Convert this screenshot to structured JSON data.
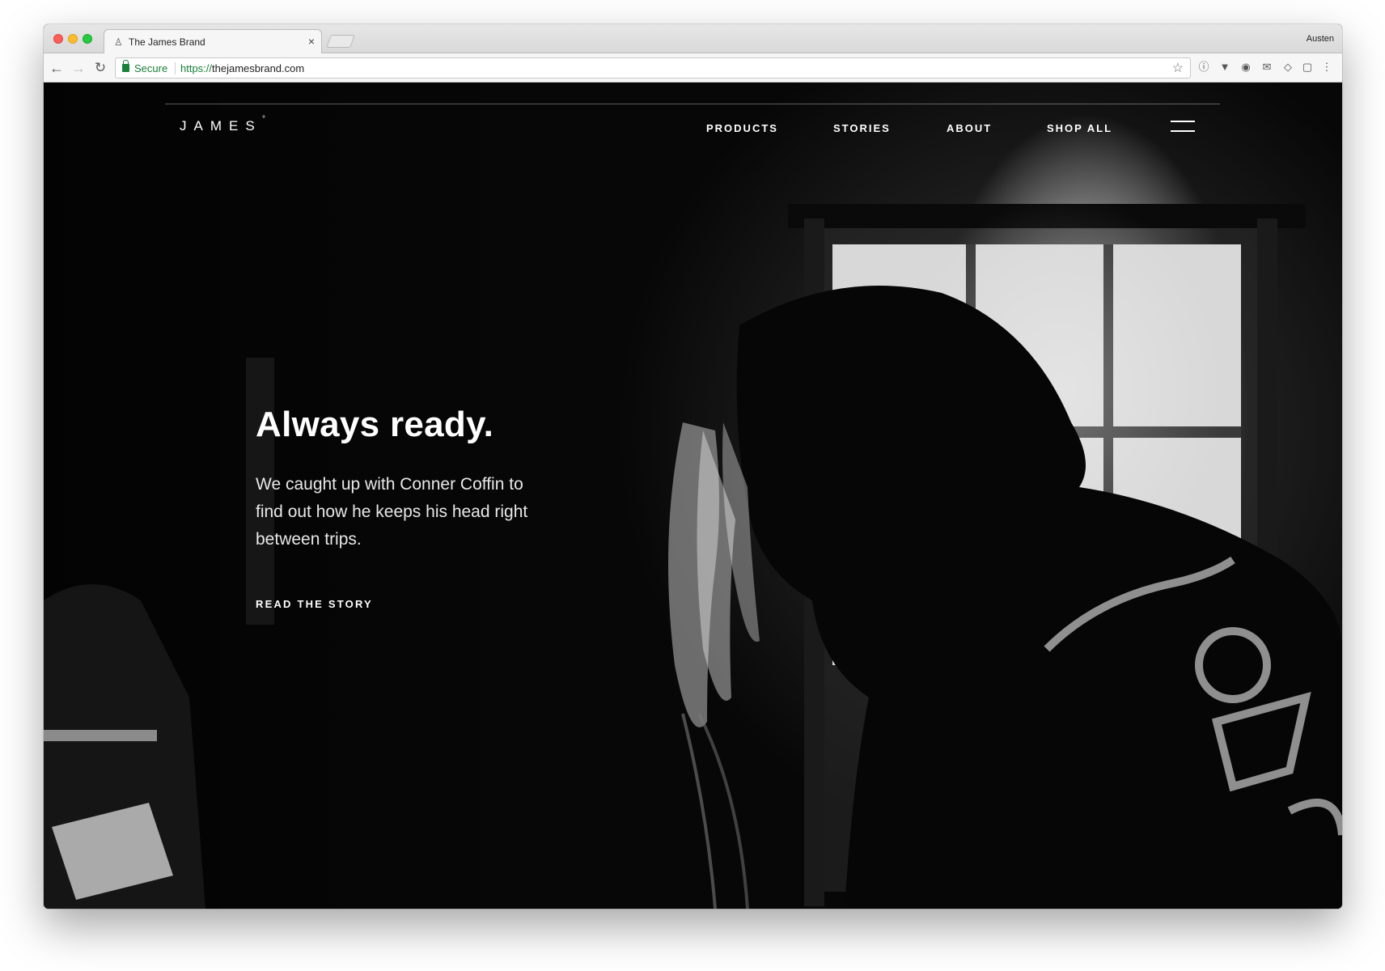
{
  "browser": {
    "tab_title": "The James Brand",
    "tab_close": "×",
    "profile_name": "Austen",
    "secure_label": "Secure",
    "url_scheme": "https://",
    "url_host": "thejamesbrand.com"
  },
  "site": {
    "logo": "JAMES",
    "logo_mark": "°",
    "nav": {
      "products": "PRODUCTS",
      "stories": "STORIES",
      "about": "ABOUT",
      "shop_all": "SHOP ALL"
    },
    "hero": {
      "headline": "Always ready.",
      "body": "We caught up with Conner Coffin to find out how he keeps his head right between trips.",
      "cta": "READ THE STORY"
    }
  },
  "icons": {
    "back": "arrow-left-icon",
    "forward": "arrow-right-icon",
    "reload": "reload-icon",
    "lock": "lock-icon",
    "bookmark": "star-icon",
    "menu": "hamburger-icon"
  },
  "colors": {
    "secure_green": "#188038",
    "traffic_red": "#fc5f57",
    "traffic_yellow": "#fdbc2e",
    "traffic_green": "#28c840",
    "hero_text": "#ffffff"
  }
}
